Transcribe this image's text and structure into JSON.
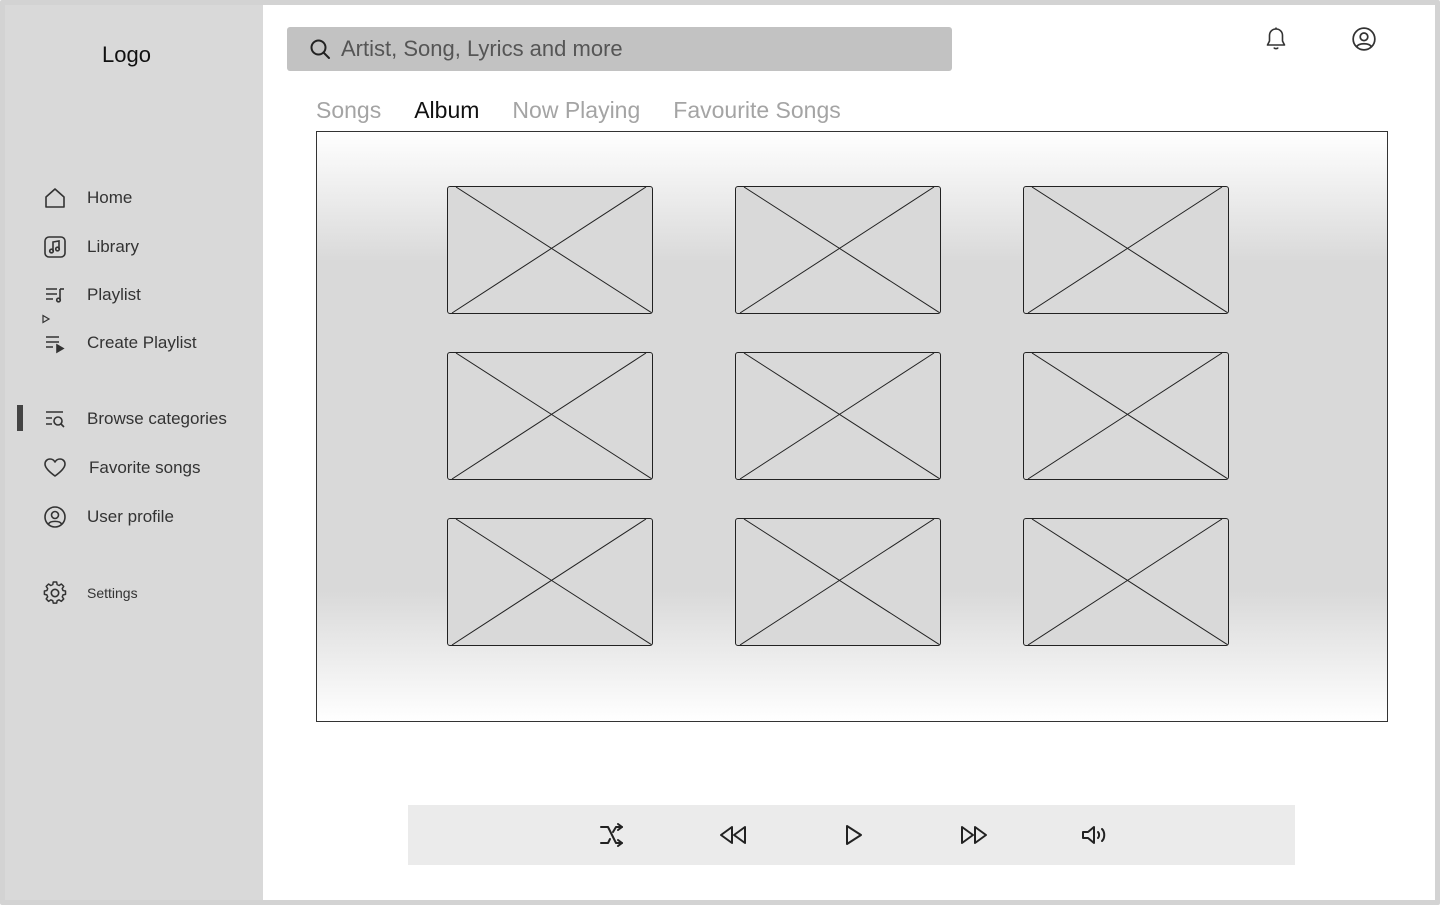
{
  "sidebar": {
    "logo": "Logo",
    "items": [
      {
        "label": "Home",
        "icon": "home-icon"
      },
      {
        "label": "Library",
        "icon": "music-library-icon"
      },
      {
        "label": "Playlist",
        "icon": "playlist-icon"
      },
      {
        "label": "Create Playlist",
        "icon": "create-playlist-icon"
      },
      {
        "label": "Browse categories",
        "icon": "browse-search-icon"
      },
      {
        "label": "Favorite songs",
        "icon": "heart-icon"
      },
      {
        "label": "User profile",
        "icon": "user-circle-icon"
      },
      {
        "label": "Settings",
        "icon": "gear-icon"
      }
    ],
    "active_item": "Browse categories"
  },
  "header": {
    "search": {
      "placeholder": "Artist, Song, Lyrics and more",
      "icon": "search-icon"
    },
    "icons": [
      "bell-icon",
      "user-circle-icon"
    ]
  },
  "tabs": [
    {
      "label": "Songs",
      "active": false
    },
    {
      "label": "Album",
      "active": true
    },
    {
      "label": "Now Playing",
      "active": false
    },
    {
      "label": "Favourite Songs",
      "active": false
    }
  ],
  "album_grid": {
    "rows": 3,
    "columns": 3,
    "item_type": "image-placeholder"
  },
  "player": {
    "controls": [
      "shuffle-icon",
      "rewind-icon",
      "play-icon",
      "fast-forward-icon",
      "volume-icon"
    ]
  },
  "colors": {
    "sidebar_bg": "#d9d9d9",
    "search_bg": "#c2c2c2",
    "player_bg": "#ebebeb",
    "tab_inactive": "#a4a4a4",
    "tab_active": "#111111"
  }
}
